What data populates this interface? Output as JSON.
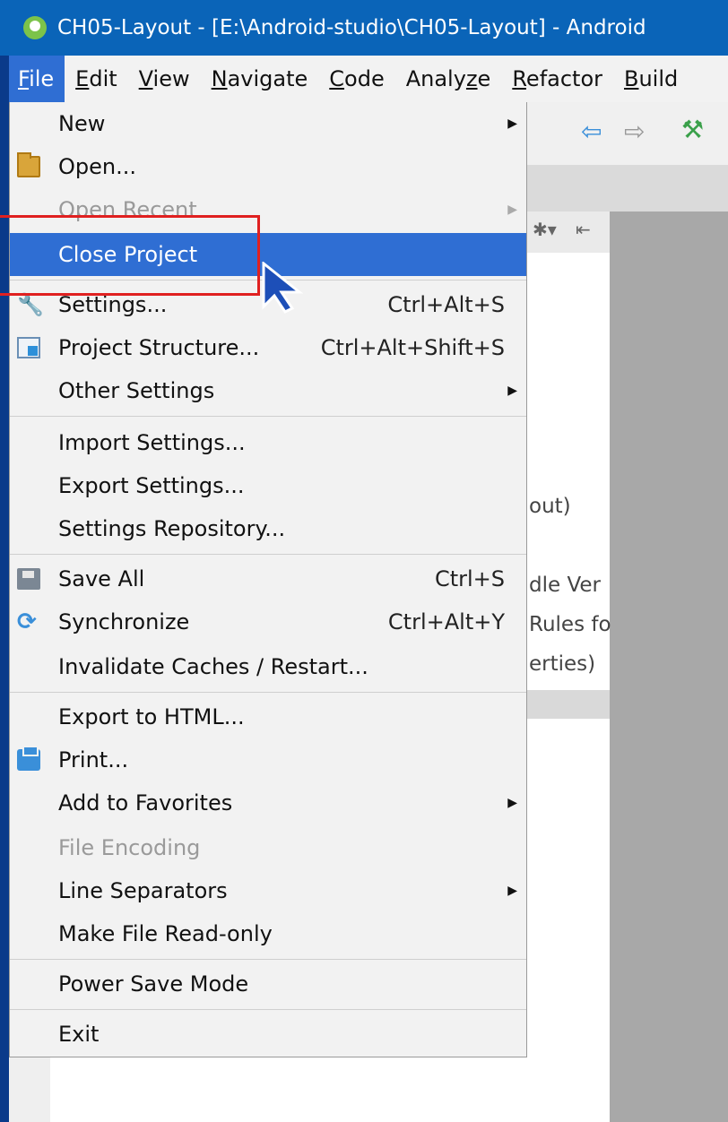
{
  "window": {
    "title": "CH05-Layout - [E:\\Android-studio\\CH05-Layout] - Android"
  },
  "menubar": {
    "items": [
      {
        "key": "F",
        "rest": "ile"
      },
      {
        "key": "E",
        "rest": "dit"
      },
      {
        "key": "V",
        "rest": "iew"
      },
      {
        "key": "N",
        "rest": "avigate"
      },
      {
        "key": "C",
        "rest": "ode"
      },
      {
        "pre": "Analy",
        "key": "z",
        "rest": "e"
      },
      {
        "key": "R",
        "rest": "efactor"
      },
      {
        "key": "B",
        "rest": "uild"
      }
    ]
  },
  "file_menu": {
    "new": "New",
    "open": "Open...",
    "open_recent": "Open Recent",
    "close_project": "Close Project",
    "settings": "Settings...",
    "settings_shortcut": "Ctrl+Alt+S",
    "project_structure": "Project Structure...",
    "project_structure_shortcut": "Ctrl+Alt+Shift+S",
    "other_settings": "Other Settings",
    "import_settings": "Import Settings...",
    "export_settings": "Export Settings...",
    "settings_repository": "Settings Repository...",
    "save_all": "Save All",
    "save_all_shortcut": "Ctrl+S",
    "synchronize": "Synchronize",
    "synchronize_shortcut": "Ctrl+Alt+Y",
    "invalidate_caches": "Invalidate Caches / Restart...",
    "export_html": "Export to HTML...",
    "print": "Print...",
    "add_favorites": "Add to Favorites",
    "file_encoding": "File Encoding",
    "line_separators": "Line Separators",
    "make_read_only": "Make File Read-only",
    "power_save": "Power Save Mode",
    "exit": "Exit"
  },
  "background": {
    "line1": "out)",
    "line2": "dle Ver",
    "line3": "Rules fo",
    "line4": "erties)"
  },
  "colors": {
    "titlebar": "#0a64b8",
    "selection": "#2f6ed3",
    "highlight_box": "#e02020"
  }
}
